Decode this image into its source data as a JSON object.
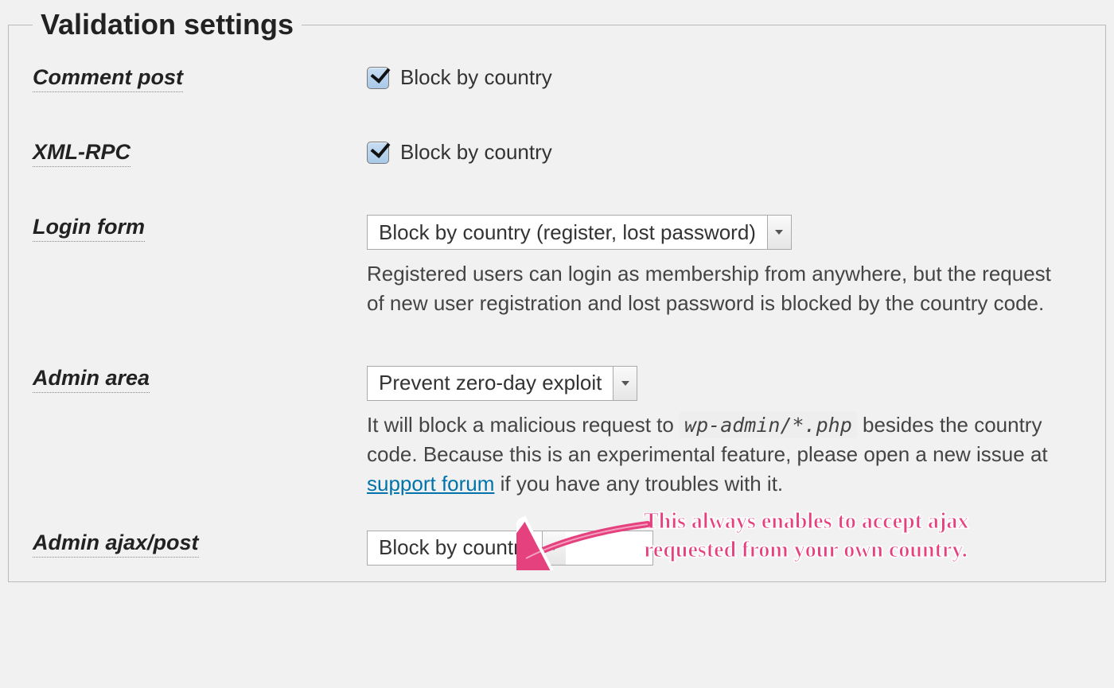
{
  "legend": "Validation settings",
  "rows": {
    "comment_post": {
      "label": "Comment post",
      "checkbox_label": "Block by country",
      "checked": true
    },
    "xml_rpc": {
      "label": "XML-RPC",
      "checkbox_label": "Block by country",
      "checked": true
    },
    "login_form": {
      "label": "Login form",
      "select_value": "Block by country (register, lost password)",
      "description": "Registered users can login as membership from anywhere, but the request of new user registration and lost password is blocked by the country code."
    },
    "admin_area": {
      "label": "Admin area",
      "select_value": "Prevent zero-day exploit",
      "description_pre": "It will block a malicious request to ",
      "code": "wp-admin/*.php",
      "description_mid": " besides the country code. Because this is an experimental feature, please open a new issue at ",
      "link_text": "support forum",
      "description_post": " if you have any troubles with it."
    },
    "admin_ajax": {
      "label": "Admin ajax/post",
      "select_value": "Block by country"
    }
  },
  "annotation": {
    "line1": "This always enables to accept ajax",
    "line2": "requested from your own country."
  }
}
